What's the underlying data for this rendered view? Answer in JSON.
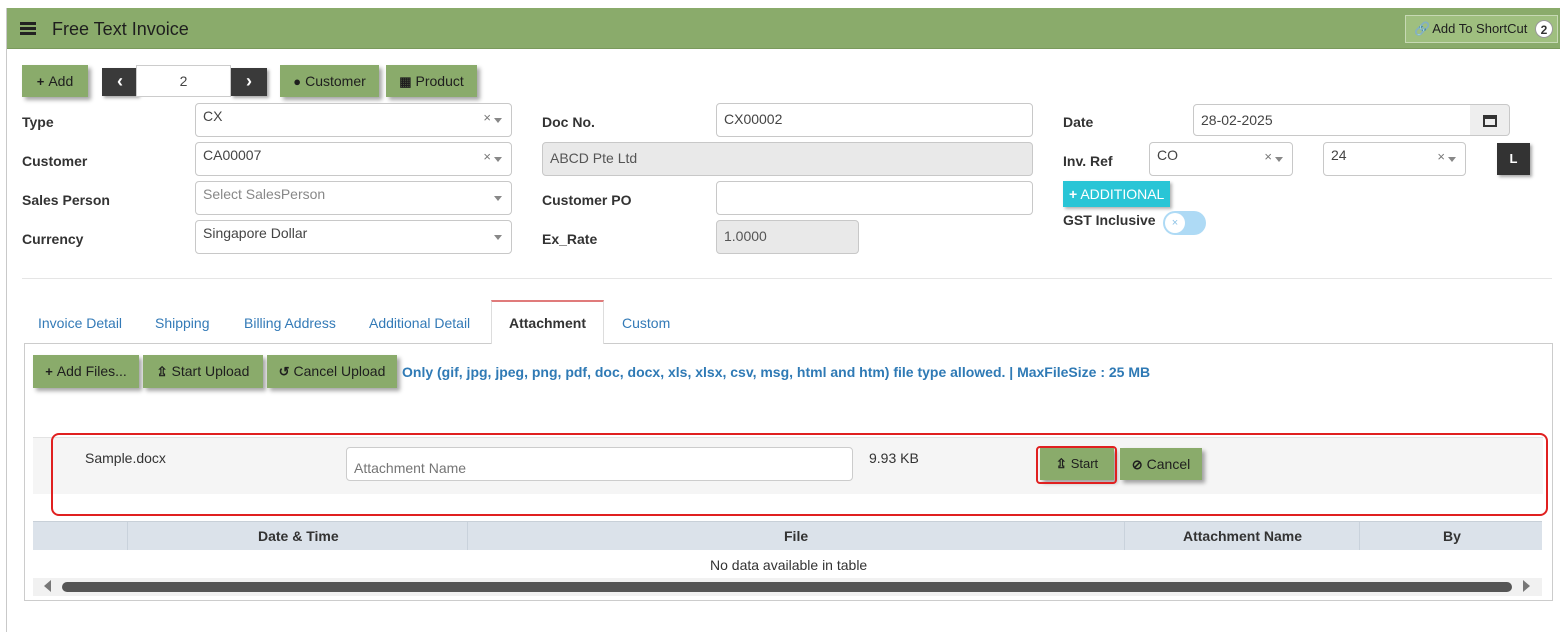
{
  "header": {
    "title": "Free Text Invoice",
    "shortcut_label": "Add To ShortCut",
    "shortcut_badge": "2"
  },
  "toolbar": {
    "add_label": "Add",
    "record_number": "2",
    "customer_label": "Customer",
    "product_label": "Product"
  },
  "form": {
    "type": {
      "label": "Type",
      "value": "CX"
    },
    "customer": {
      "label": "Customer",
      "value": "CA00007"
    },
    "sales_person": {
      "label": "Sales Person",
      "placeholder": "Select SalesPerson"
    },
    "currency": {
      "label": "Currency",
      "value": "Singapore Dollar"
    },
    "doc_no": {
      "label": "Doc No.",
      "value": "CX00002"
    },
    "customer_name": {
      "value": "ABCD Pte Ltd"
    },
    "customer_po": {
      "label": "Customer PO",
      "value": ""
    },
    "ex_rate": {
      "label": "Ex_Rate",
      "value": "1.0000"
    },
    "date": {
      "label": "Date",
      "value": "28-02-2025"
    },
    "inv_ref": {
      "label": "Inv. Ref",
      "prefix": "CO",
      "number": "24"
    },
    "l_button": "L",
    "additional_label": "ADDITIONAL",
    "gst_inclusive": {
      "label": "GST Inclusive",
      "checked": false
    }
  },
  "tabs": [
    {
      "label": "Invoice Detail"
    },
    {
      "label": "Shipping"
    },
    {
      "label": "Billing Address"
    },
    {
      "label": "Additional Detail"
    },
    {
      "label": "Attachment"
    },
    {
      "label": "Custom"
    }
  ],
  "attachment": {
    "add_files_label": "Add Files...",
    "start_upload_label": "Start Upload",
    "cancel_upload_label": "Cancel Upload",
    "hint": "Only (gif, jpg, jpeg, png, pdf, doc, docx, xls, xlsx, csv, msg, html and htm) file type allowed. | MaxFileSize : 25 MB",
    "pending_file": {
      "name": "Sample.docx",
      "attachment_name_placeholder": "Attachment Name",
      "size": "9.93 KB",
      "start_label": "Start",
      "cancel_label": "Cancel"
    },
    "table": {
      "columns": [
        "Date & Time",
        "File",
        "Attachment Name",
        "By"
      ],
      "empty_text": "No data available in table"
    }
  },
  "colors": {
    "header_green": "#8aab6b",
    "link_blue": "#337ab7",
    "hint_blue": "#2f7ab5",
    "additional_cyan": "#29c5d6",
    "highlight_red": "#e02020"
  }
}
